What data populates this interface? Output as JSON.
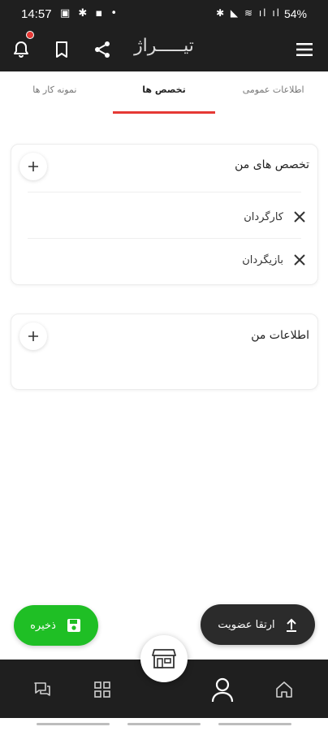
{
  "status_bar": {
    "time": "14:57",
    "left_icons": "▣ ✱ ▪ •",
    "right_icons": "✱ ◣ ≋ ıl ıl",
    "battery": "54%"
  },
  "app": {
    "logo": "تیـــــراژ",
    "icons": {
      "bell": "bell-icon",
      "bookmark": "bookmark-icon",
      "share": "share-icon",
      "menu": "menu-icon"
    }
  },
  "tabs": [
    {
      "label": "اطلاعات عمومی",
      "active": false
    },
    {
      "label": "تخصص ها",
      "active": true
    },
    {
      "label": "نمونه کار ها",
      "active": false
    }
  ],
  "skills_card": {
    "title": "تخصص های من",
    "items": [
      "کارگردان",
      "بازیگردان"
    ]
  },
  "info_card": {
    "title": "اطلاعات من"
  },
  "buttons": {
    "save_label": "ذخیره",
    "upgrade_label": "ارتقا عضویت"
  },
  "bottom_nav": [
    "messages-icon",
    "grid-icon",
    "store-icon",
    "profile-icon",
    "home-icon"
  ],
  "colors": {
    "accent_red": "#e53935",
    "save_green": "#1fbf25",
    "dark_bar": "#1f1f1f"
  }
}
